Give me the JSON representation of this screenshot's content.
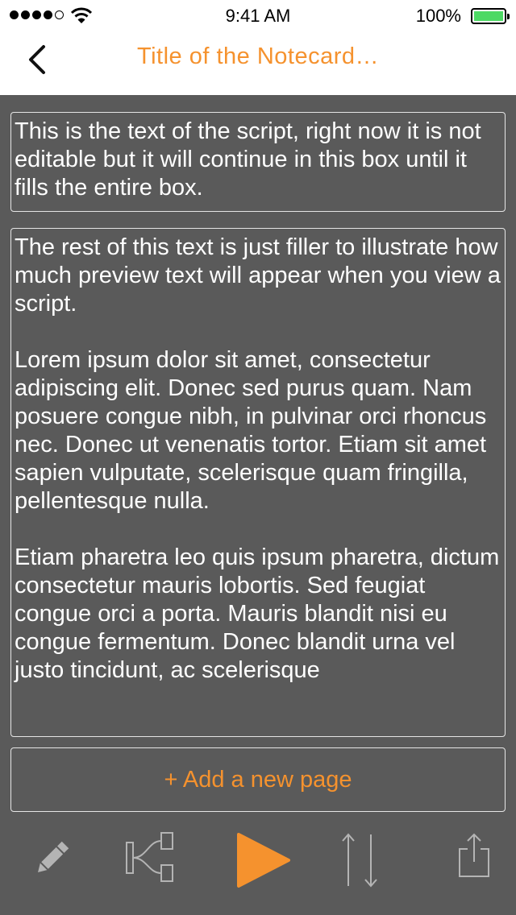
{
  "status_bar": {
    "time": "9:41 AM",
    "battery": "100%",
    "colors": {
      "battery_fill": "#4cd964"
    }
  },
  "nav": {
    "back_icon": "chevron-left-icon",
    "title": "Title of the Notecard…"
  },
  "script": {
    "preview_text": "This is the text of the script, right now it is not editable but it will continue in this box until it fills the entire box.",
    "body_text": "The rest of this text is just filler to illustrate how much preview text will appear when you view a script.\n\nLorem ipsum dolor sit amet, consectetur adipiscing elit. Donec sed purus quam. Nam posuere congue nibh, in pulvinar orci rhoncus nec. Donec ut venenatis tortor. Etiam sit amet sapien vulputate, scelerisque quam fringilla, pellentesque nulla.\n\nEtiam pharetra leo quis ipsum pharetra, dictum consectetur mauris lobortis. Sed feugiat congue orci a porta. Mauris blandit nisi eu congue fermentum. Donec blandit urna vel justo tincidunt, ac scelerisque"
  },
  "add_page": {
    "label": "+ Add a new page"
  },
  "toolbar": {
    "icons": [
      "pencil-icon",
      "branch-icon",
      "play-icon",
      "reorder-icon",
      "share-icon"
    ]
  },
  "colors": {
    "accent": "#f5922e",
    "background": "#5a5a5a",
    "header": "#ffffff",
    "text": "#ffffff",
    "icon_gray": "#b4b4b4"
  }
}
